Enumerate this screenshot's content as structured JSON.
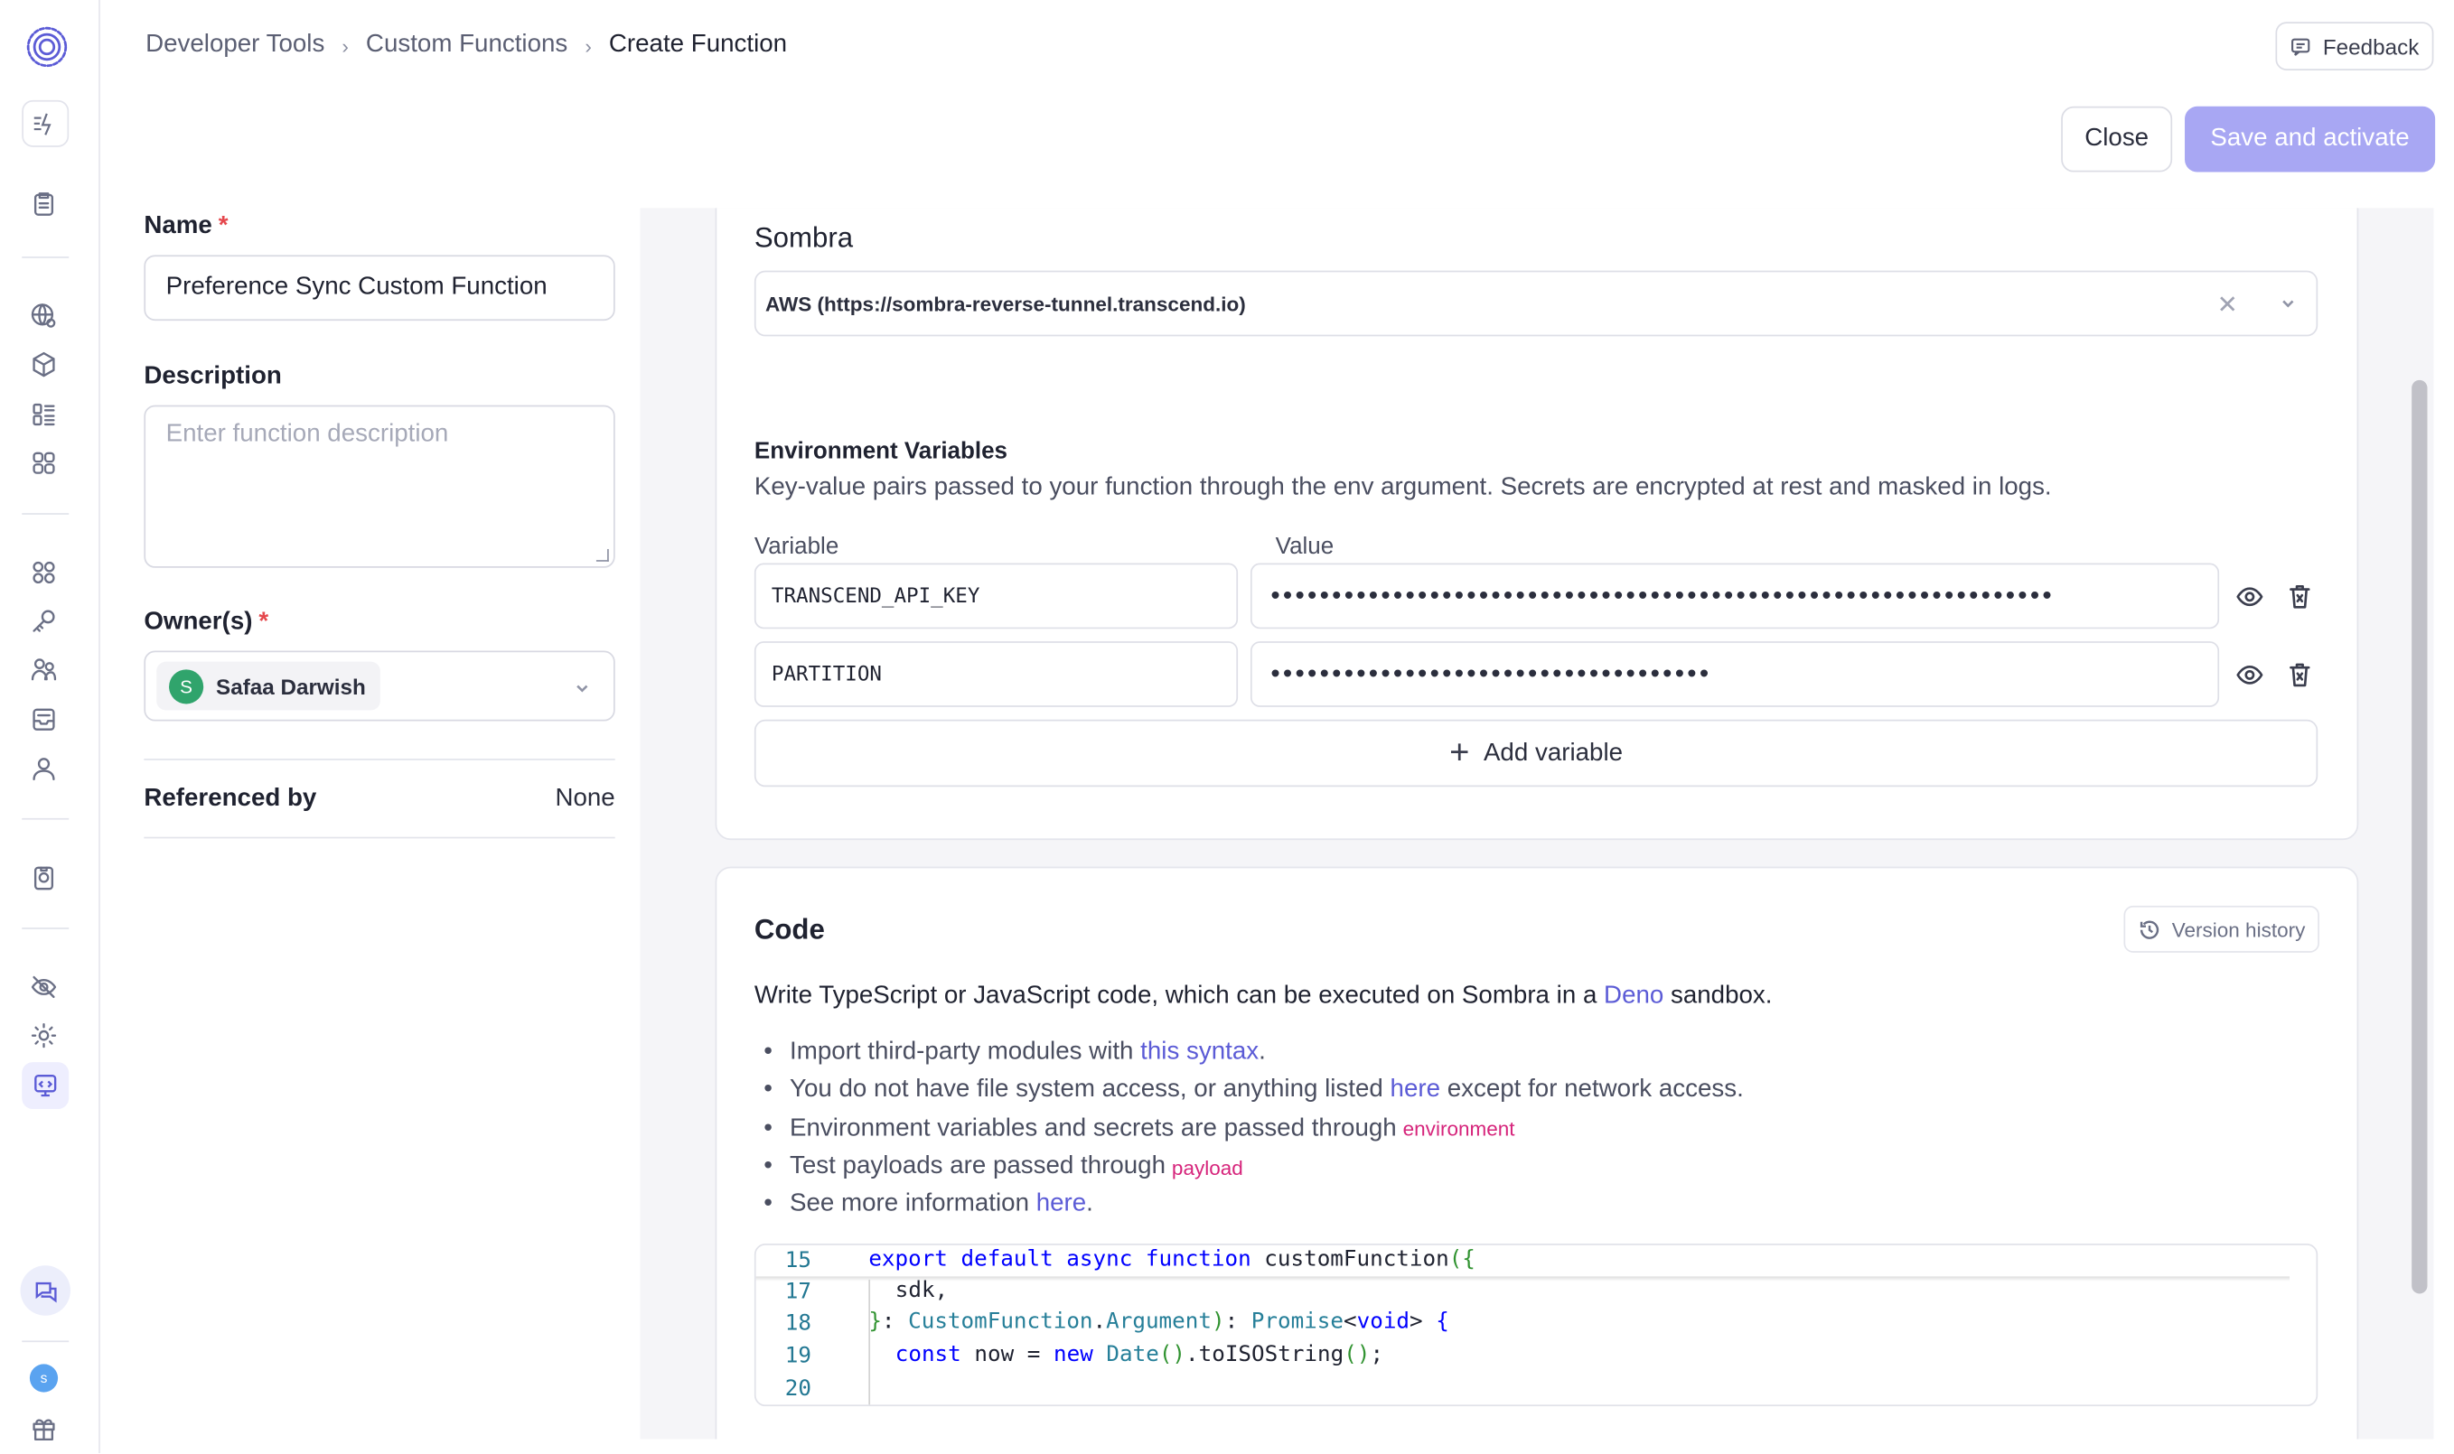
{
  "breadcrumb": [
    "Developer Tools",
    "Custom Functions",
    "Create Function"
  ],
  "header": {
    "feedback_label": "Feedback",
    "close_label": "Close",
    "save_label": "Save and activate",
    "save_color": "#a8a7f3"
  },
  "sidebar": {
    "icons": [
      "activity-icon",
      "clipboard-icon",
      "globe-icon",
      "cube-icon",
      "dashboard-icon",
      "apps-icon",
      "integrations-icon",
      "key-icon",
      "users-icon",
      "inbox-icon",
      "user-icon",
      "assessment-icon",
      "eye-off-icon",
      "gear-icon",
      "developer-tools-icon",
      "chat-icon",
      "gift-icon"
    ],
    "avatar_initial": "s",
    "active_item": "developer-tools-icon"
  },
  "form": {
    "name_label": "Name",
    "name_value": "Preference Sync Custom Function",
    "description_label": "Description",
    "description_placeholder": "Enter function description",
    "owners_label": "Owner(s)",
    "owner": {
      "initial": "S",
      "name": "Safaa Darwish",
      "color": "#30a46c"
    },
    "required_mark": "*",
    "referenced_by_label": "Referenced by",
    "referenced_by_value": "None"
  },
  "sombra": {
    "title": "Sombra",
    "selected": "AWS (https://sombra-reverse-tunnel.transcend.io)",
    "clear_glyph": "✕"
  },
  "env": {
    "title": "Environment Variables",
    "description": "Key-value pairs passed to your function through the env argument. Secrets are encrypted at rest and masked in logs.",
    "variable_header": "Variable",
    "value_header": "Value",
    "rows": [
      {
        "key": "TRANSCEND_API_KEY",
        "value": "••••••••••••••••••••••••••••••••••••••••••••••••••••••••••••••••"
      },
      {
        "key": "PARTITION",
        "value": "••••••••••••••••••••••••••••••••••••"
      }
    ],
    "add_label": "Add variable"
  },
  "code": {
    "title": "Code",
    "version_history_label": "Version history",
    "intro_before": "Write TypeScript or JavaScript code, which can be executed on Sombra in a ",
    "intro_link": "Deno",
    "intro_after": " sandbox.",
    "bullets": {
      "b1_before": "Import third-party modules with ",
      "b1_link": "this syntax",
      "b1_after": ".",
      "b2_before": "You do not have file system access, or anything listed ",
      "b2_link": "here",
      "b2_after": " except for network access.",
      "b3_before": "Environment variables and secrets are passed through",
      "b3_code": "environment",
      "b4_before": "Test payloads are passed through",
      "b4_code": "payload",
      "b5_before": "See more information ",
      "b5_link": "here",
      "b5_after": "."
    },
    "line_numbers": [
      "15",
      "17",
      "18",
      "19",
      "20"
    ]
  }
}
